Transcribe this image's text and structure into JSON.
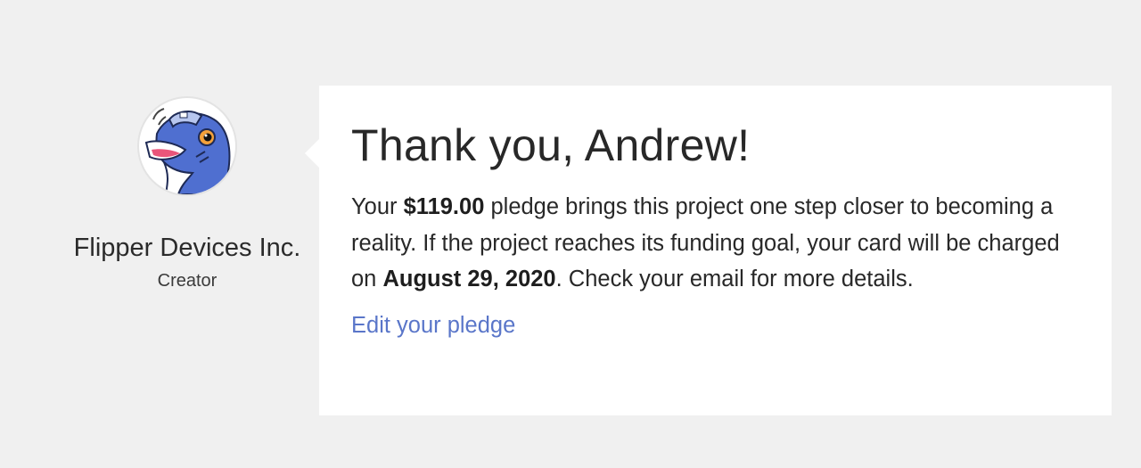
{
  "creator": {
    "name": "Flipper Devices Inc.",
    "role": "Creator",
    "avatar_icon": "dolphin-avatar-icon"
  },
  "card": {
    "title": "Thank you, Andrew!",
    "message": {
      "part1": "Your ",
      "amount": "$119.00",
      "part2": " pledge brings this project one step closer to becoming a reality. If the project reaches its funding goal, your card will be charged on ",
      "date": "August 29, 2020",
      "part3": ". Check your email for more details."
    },
    "edit_link": "Edit your pledge"
  },
  "colors": {
    "background": "#f0f0f0",
    "card": "#ffffff",
    "link": "#5a76c9",
    "text": "#282828"
  }
}
